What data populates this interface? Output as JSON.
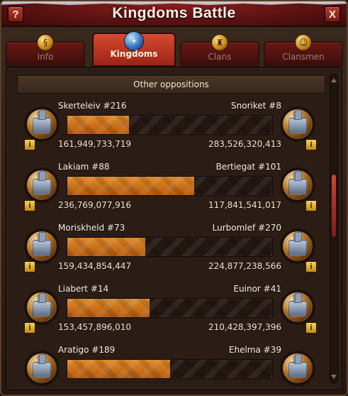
{
  "window": {
    "title": "Kingdoms Battle",
    "help_label": "?",
    "close_label": "X"
  },
  "tabs": [
    {
      "label": "Info",
      "icon": "info-scroll-icon",
      "active": false
    },
    {
      "label": "Kingdoms",
      "icon": "kingdom-globe-icon",
      "active": true
    },
    {
      "label": "Clans",
      "icon": "clan-icon",
      "active": false
    },
    {
      "label": "Clansmen",
      "icon": "clansmen-icon",
      "active": false
    }
  ],
  "section": {
    "title": "Other oppositions"
  },
  "battles": [
    {
      "left": {
        "name": "Skerteleiv #216",
        "score": "161,949,733,719"
      },
      "right": {
        "name": "Snoriket #8",
        "score": "283,526,320,413"
      },
      "progress": 0.3
    },
    {
      "left": {
        "name": "Lakiam #88",
        "score": "236,769,077,916"
      },
      "right": {
        "name": "Bertiegat #101",
        "score": "117,841,541,017"
      },
      "progress": 0.62
    },
    {
      "left": {
        "name": "Moriskheld #73",
        "score": "159,434,854,447"
      },
      "right": {
        "name": "Lurbomlef #270",
        "score": "224,877,238,566"
      },
      "progress": 0.38
    },
    {
      "left": {
        "name": "Liabert #14",
        "score": "153,457,896,010"
      },
      "right": {
        "name": "Euinor #41",
        "score": "210,428,397,396"
      },
      "progress": 0.4
    },
    {
      "left": {
        "name": "Aratigo #189",
        "score": ""
      },
      "right": {
        "name": "Ehelma #39",
        "score": ""
      },
      "progress": 0.5
    }
  ],
  "buttons": {
    "info_label": "i"
  }
}
